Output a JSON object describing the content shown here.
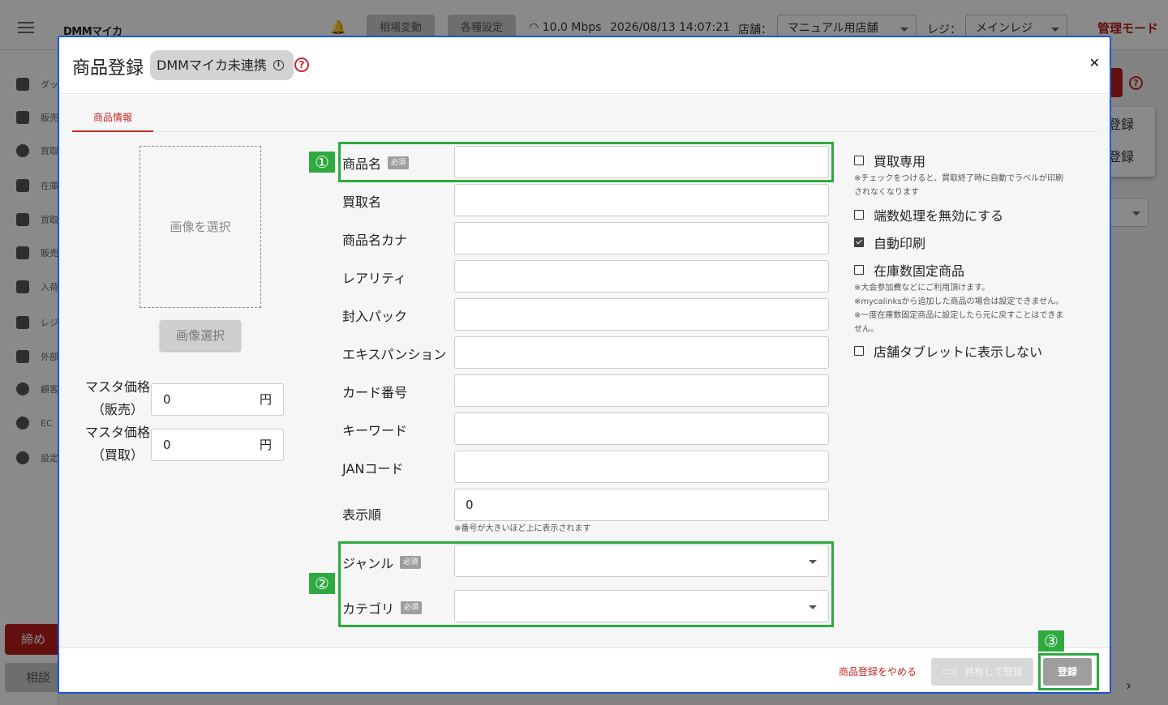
{
  "topbar": {
    "brand": "DMMマイカ",
    "market_btn": "相場変動",
    "settings_btn": "各種設定",
    "network": "10.0 Mbps",
    "datetime": "2026/08/13 14:07:21",
    "store_label": "店舗：",
    "store_value": "マニュアル用店舗",
    "register_label": "レジ：",
    "register_value": "メインレジ",
    "admin_mode": "管理モード"
  },
  "sidebar": {
    "items": [
      {
        "label": "ダッシュボード"
      },
      {
        "label": "販売"
      },
      {
        "label": "買取"
      },
      {
        "label": "在庫"
      },
      {
        "label": "買取"
      },
      {
        "label": "販売"
      },
      {
        "label": "入荷"
      },
      {
        "label": "レジ"
      },
      {
        "label": "外部"
      },
      {
        "label": "顧客"
      },
      {
        "label": "EC"
      },
      {
        "label": "設定"
      }
    ],
    "close_btn": "締め",
    "consult_btn": "相談"
  },
  "background_right": {
    "menu_item1": "登録",
    "menu_item2": "登録"
  },
  "modal": {
    "title": "商品登録",
    "badge": "DMMマイカ未連携",
    "tab": "商品情報",
    "image_placeholder": "画像を選択",
    "image_button": "画像選択",
    "master_sell_label1": "マスタ価格",
    "master_sell_label2": "（販売）",
    "master_sell_value": "0",
    "master_buy_label1": "マスタ価格",
    "master_buy_label2": "（買取）",
    "master_buy_value": "0",
    "yen": "円",
    "required": "必須",
    "fields": {
      "product_name": {
        "label": "商品名",
        "value": ""
      },
      "buy_name": {
        "label": "買取名",
        "value": ""
      },
      "product_kana": {
        "label": "商品名カナ",
        "value": ""
      },
      "rarity": {
        "label": "レアリティ",
        "value": ""
      },
      "pack": {
        "label": "封入パック",
        "value": ""
      },
      "expansion": {
        "label": "エキスパンション",
        "value": ""
      },
      "card_number": {
        "label": "カード番号",
        "value": ""
      },
      "keyword": {
        "label": "キーワード",
        "value": ""
      },
      "jan": {
        "label": "JANコード",
        "value": ""
      },
      "display_order": {
        "label": "表示順",
        "value": "0"
      }
    },
    "display_order_hint": "※番号が大きいほど上に表示されます",
    "genre": {
      "label": "ジャンル",
      "value": ""
    },
    "category": {
      "label": "カテゴリ",
      "value": ""
    },
    "checkboxes": {
      "buy_only": {
        "label": "買取専用",
        "checked": false
      },
      "buy_only_note1": "※チェックをつけると、買取終了時に自動でラベルが印刷",
      "buy_only_note2": "されなくなります",
      "disable_rounding": {
        "label": "端数処理を無効にする",
        "checked": false
      },
      "auto_print": {
        "label": "自動印刷",
        "checked": true
      },
      "fixed_stock": {
        "label": "在庫数固定商品",
        "checked": false
      },
      "fixed_note1": "※大会参加費などにご利用頂けます。",
      "fixed_note2": "※mycalinksから追加した商品の場合は設定できません。",
      "fixed_note3": "※一度在庫数固定商品に設定したら元に戻すことはできま",
      "fixed_note4": "せん。",
      "hide_tablet": {
        "label": "店舗タブレットに表示しない",
        "checked": false
      }
    },
    "footer": {
      "cancel": "商品登録をやめる",
      "share": "共有して登録",
      "register": "登録"
    },
    "annotations": [
      "①",
      "②",
      "③"
    ]
  },
  "colors": {
    "accent": "#c62828",
    "highlight": "#2eaa3f",
    "modal_border": "#1a56db"
  }
}
